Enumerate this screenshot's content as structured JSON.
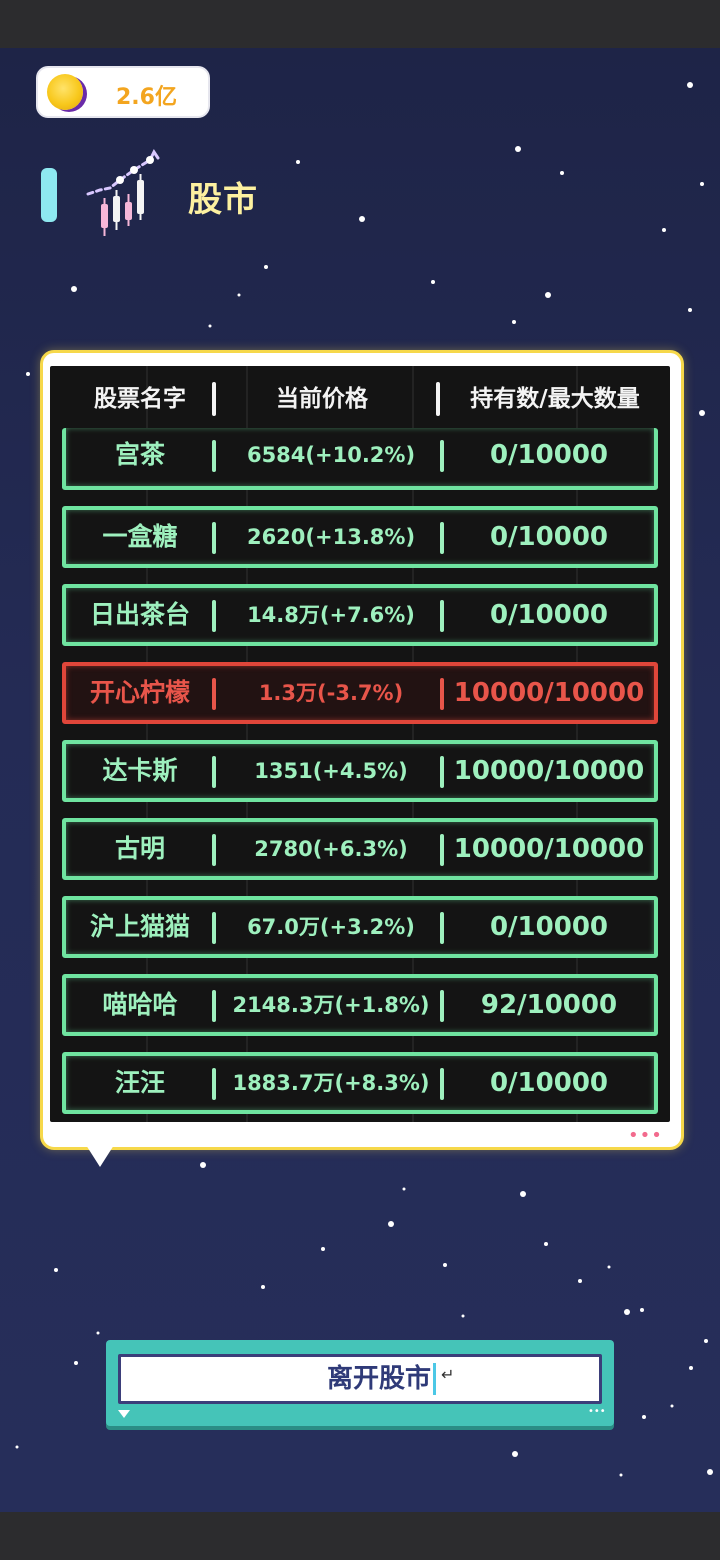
{
  "header": {
    "coin_value": "2.6亿",
    "title": "股市"
  },
  "table": {
    "columns": [
      "股票名字",
      "当前价格",
      "持有数/最大数量"
    ],
    "rows": [
      {
        "name": "宫茶",
        "price": "6584(+10.2%)",
        "holding": "0/10000",
        "status": "up"
      },
      {
        "name": "一盒糖",
        "price": "2620(+13.8%)",
        "holding": "0/10000",
        "status": "up"
      },
      {
        "name": "日出茶台",
        "price": "14.8万(+7.6%)",
        "holding": "0/10000",
        "status": "up"
      },
      {
        "name": "开心柠檬",
        "price": "1.3万(-3.7%)",
        "holding": "10000/10000",
        "status": "down"
      },
      {
        "name": "达卡斯",
        "price": "1351(+4.5%)",
        "holding": "10000/10000",
        "status": "up"
      },
      {
        "name": "古明",
        "price": "2780(+6.3%)",
        "holding": "10000/10000",
        "status": "up"
      },
      {
        "name": "沪上猫猫",
        "price": "67.0万(+3.2%)",
        "holding": "0/10000",
        "status": "up"
      },
      {
        "name": "喵哈哈",
        "price": "2148.3万(+1.8%)",
        "holding": "92/10000",
        "status": "up"
      },
      {
        "name": "汪汪",
        "price": "1883.7万(+8.3%)",
        "holding": "0/10000",
        "status": "up"
      }
    ]
  },
  "panel_more": "•••",
  "leave_button": {
    "label": "离开股市",
    "enter_glyph": "↵"
  },
  "colors": {
    "up": "#9ef0be",
    "up_border": "#6fe4a0",
    "down": "#e8554a",
    "down_border": "#e0463a",
    "coin_text": "#f3a51f",
    "title": "#fdf1a0",
    "panel_border": "#f6d84a",
    "button_frame": "#45c4b8"
  },
  "icons": {
    "coin": "gold-coin-icon",
    "title": "candlestick-chart-icon",
    "more": "more-dots-icon"
  }
}
